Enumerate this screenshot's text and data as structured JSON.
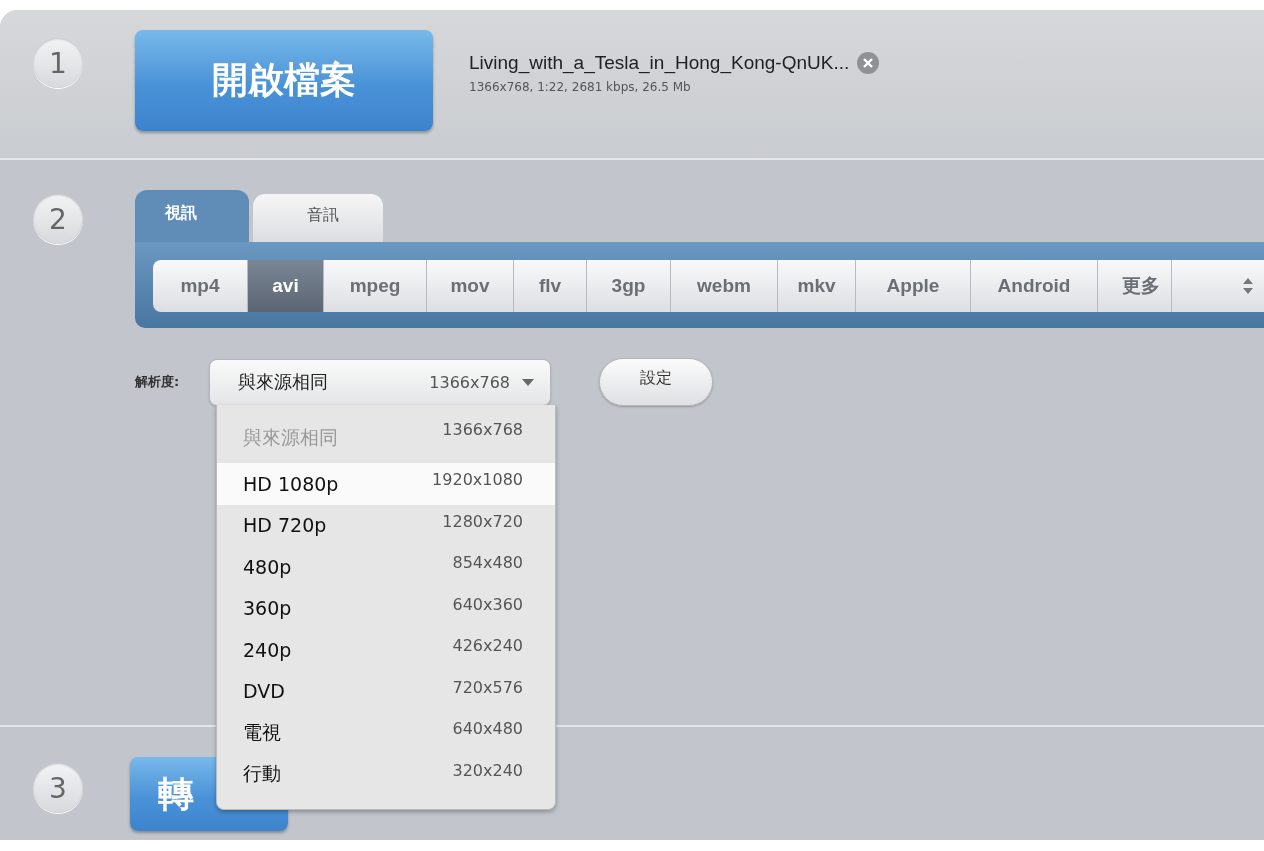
{
  "steps": [
    "1",
    "2",
    "3"
  ],
  "open_button": {
    "label": "開啟檔案"
  },
  "file": {
    "name": "Living_with_a_Tesla_in_Hong_Kong-QnUK...",
    "info": "1366x768, 1:22, 2681 kbps, 26.5 Mb"
  },
  "media_tabs": [
    {
      "label": "視訊",
      "selected": true
    },
    {
      "label": "音訊",
      "selected": false
    }
  ],
  "formats": [
    {
      "label": "mp4",
      "selected": false
    },
    {
      "label": "avi",
      "selected": true
    },
    {
      "label": "mpeg",
      "selected": false
    },
    {
      "label": "mov",
      "selected": false
    },
    {
      "label": "flv",
      "selected": false
    },
    {
      "label": "3gp",
      "selected": false
    },
    {
      "label": "webm",
      "selected": false
    },
    {
      "label": "mkv",
      "selected": false
    },
    {
      "label": "Apple",
      "selected": false
    },
    {
      "label": "Android",
      "selected": false
    },
    {
      "label": "更多",
      "selected": false
    }
  ],
  "resolution": {
    "label": "解析度:",
    "value": "與來源相同",
    "size": "1366x768"
  },
  "settings_button": {
    "label": "設定"
  },
  "resolution_options": [
    {
      "name": "與來源相同",
      "size": "1366x768",
      "disabled": true,
      "selected": false
    },
    {
      "name": "HD 1080p",
      "size": "1920x1080",
      "disabled": false,
      "selected": true
    },
    {
      "name": "HD 720p",
      "size": "1280x720",
      "disabled": false,
      "selected": false
    },
    {
      "name": "480p",
      "size": "854x480",
      "disabled": false,
      "selected": false
    },
    {
      "name": "360p",
      "size": "640x360",
      "disabled": false,
      "selected": false
    },
    {
      "name": "240p",
      "size": "426x240",
      "disabled": false,
      "selected": false
    },
    {
      "name": "DVD",
      "size": "720x576",
      "disabled": false,
      "selected": false
    },
    {
      "name": "電視",
      "size": "640x480",
      "disabled": false,
      "selected": false
    },
    {
      "name": "行動",
      "size": "320x240",
      "disabled": false,
      "selected": false
    }
  ],
  "convert_button": {
    "label": "轉"
  }
}
